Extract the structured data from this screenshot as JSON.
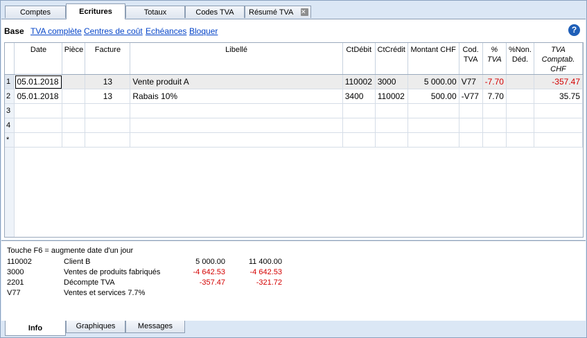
{
  "tabs": [
    "Comptes",
    "Ecritures",
    "Totaux",
    "Codes TVA",
    "Résumé TVA"
  ],
  "close_glyph": "✕",
  "subnav": {
    "current": "Base",
    "links": [
      "TVA complète",
      "Centres de coût",
      "Echéances",
      "Bloquer"
    ]
  },
  "help_glyph": "?",
  "columns": [
    "Date",
    "Pièce",
    "Facture",
    "Libellé",
    "CtDébit",
    "CtCrédit",
    "Montant CHF",
    "Cod. TVA",
    "% TVA",
    "%Non. Déd.",
    "TVA Comptab. CHF"
  ],
  "rows": [
    {
      "num": "1",
      "date": "05.01.2018",
      "piece": "",
      "facture": "13",
      "libelle": "Vente produit A",
      "ctdebit": "110002",
      "ctcredit": "3000",
      "montant": "5 000.00",
      "codtva": "V77",
      "pcttva": "-7.70",
      "nonded": "",
      "tvacomptab": "-357.47"
    },
    {
      "num": "2",
      "date": "05.01.2018",
      "piece": "",
      "facture": "13",
      "libelle": "Rabais 10%",
      "ctdebit": "3400",
      "ctcredit": "110002",
      "montant": "500.00",
      "codtva": "-V77",
      "pcttva": "7.70",
      "nonded": "",
      "tvacomptab": "35.75"
    },
    {
      "num": "3"
    },
    {
      "num": "4"
    },
    {
      "num": "*"
    }
  ],
  "info": {
    "hint": "Touche F6 = augmente date d'un jour",
    "lines": [
      {
        "code": "110002",
        "name": "Client B",
        "v1": "5 000.00",
        "v2": "11 400.00"
      },
      {
        "code": "3000",
        "name": "Ventes de produits fabriqués",
        "v1": "-4 642.53",
        "v2": "-4 642.53"
      },
      {
        "code": "2201",
        "name": "Décompte TVA",
        "v1": "-357.47",
        "v2": "-321.72"
      },
      {
        "code": "V77",
        "name": "Ventes et services 7.7%",
        "v1": "",
        "v2": ""
      }
    ]
  },
  "bottom_tabs": [
    "Info",
    "Graphiques",
    "Messages"
  ]
}
